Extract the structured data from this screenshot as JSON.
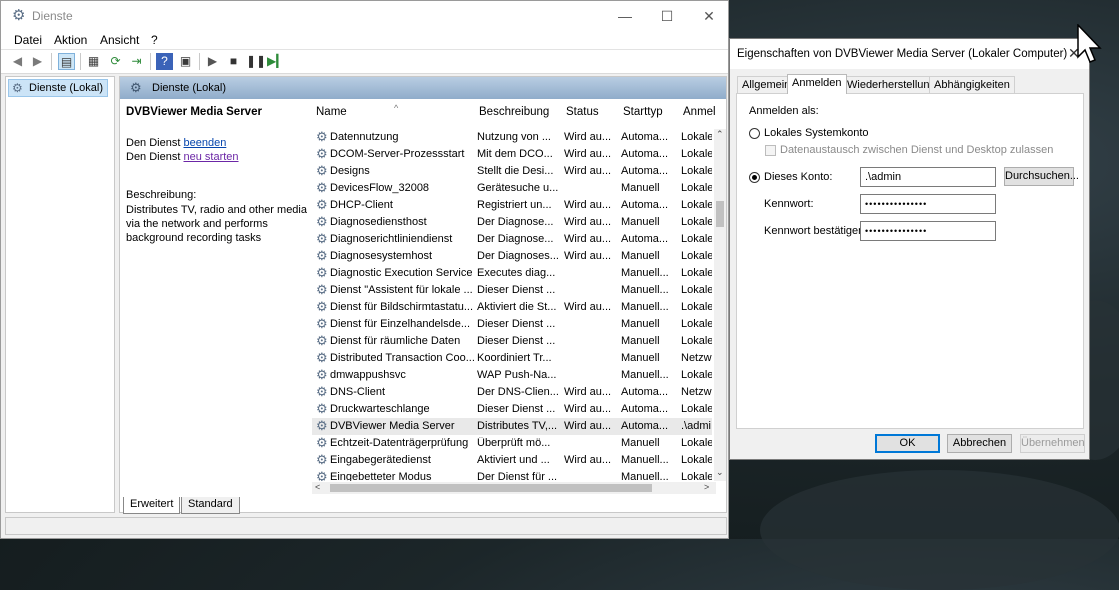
{
  "window": {
    "title": "Dienste",
    "menu": [
      "Datei",
      "Aktion",
      "Ansicht",
      "?"
    ]
  },
  "tree": {
    "item": "Dienste (Lokal)"
  },
  "content": {
    "header": "Dienste (Lokal)",
    "selected_service": "DVBViewer Media Server",
    "action1_prefix": "Den Dienst ",
    "action1_link": "beenden",
    "action2_prefix": "Den Dienst ",
    "action2_link": "neu starten",
    "desc_label": "Beschreibung:",
    "desc_text": "Distributes TV, radio and other media via the network and performs background recording tasks"
  },
  "table": {
    "columns": [
      "Name",
      "Beschreibung",
      "Status",
      "Starttyp",
      "Anmel"
    ],
    "rows": [
      [
        "Datennutzung",
        "Nutzung von ...",
        "Wird au...",
        "Automa...",
        "Lokale"
      ],
      [
        "DCOM-Server-Prozessstart",
        "Mit dem DCO...",
        "Wird au...",
        "Automa...",
        "Lokale"
      ],
      [
        "Designs",
        "Stellt die Desi...",
        "Wird au...",
        "Automa...",
        "Lokale"
      ],
      [
        "DevicesFlow_32008",
        "Gerätesuche u...",
        "",
        "Manuell",
        "Lokale"
      ],
      [
        "DHCP-Client",
        "Registriert un...",
        "Wird au...",
        "Automa...",
        "Lokale"
      ],
      [
        "Diagnosediensthost",
        "Der Diagnose...",
        "Wird au...",
        "Manuell",
        "Lokale"
      ],
      [
        "Diagnoserichtliniendienst",
        "Der Diagnose...",
        "Wird au...",
        "Automa...",
        "Lokale"
      ],
      [
        "Diagnosesystemhost",
        "Der Diagnoses...",
        "Wird au...",
        "Manuell",
        "Lokale"
      ],
      [
        "Diagnostic Execution Service",
        "Executes diag...",
        "",
        "Manuell...",
        "Lokale"
      ],
      [
        "Dienst \"Assistent für lokale ...",
        "Dieser Dienst ...",
        "",
        "Manuell...",
        "Lokale"
      ],
      [
        "Dienst für Bildschirmtastatu...",
        "Aktiviert die St...",
        "Wird au...",
        "Manuell...",
        "Lokale"
      ],
      [
        "Dienst für Einzelhandelsde...",
        "Dieser Dienst ...",
        "",
        "Manuell",
        "Lokale"
      ],
      [
        "Dienst für räumliche Daten",
        "Dieser Dienst ...",
        "",
        "Manuell",
        "Lokale"
      ],
      [
        "Distributed Transaction Coo...",
        "Koordiniert Tr...",
        "",
        "Manuell",
        "Netzw"
      ],
      [
        "dmwappushsvc",
        "WAP Push-Na...",
        "",
        "Manuell...",
        "Lokale"
      ],
      [
        "DNS-Client",
        "Der DNS-Clien...",
        "Wird au...",
        "Automa...",
        "Netzw"
      ],
      [
        "Druckwarteschlange",
        "Dieser Dienst ...",
        "Wird au...",
        "Automa...",
        "Lokale"
      ],
      [
        "DVBViewer Media Server",
        "Distributes TV,...",
        "Wird au...",
        "Automa...",
        ".\\admi"
      ],
      [
        "Echtzeit-Datenträgerprüfung",
        "Überprüft mö...",
        "",
        "Manuell",
        "Lokale"
      ],
      [
        "Eingabegerätedienst",
        "Aktiviert und ...",
        "Wird au...",
        "Manuell...",
        "Lokale"
      ],
      [
        "Eingebetteter Modus",
        "Der Dienst für ...",
        "",
        "Manuell...",
        "Lokale"
      ]
    ],
    "selected_index": 17
  },
  "view_tabs": [
    "Erweitert",
    "Standard"
  ],
  "dialog": {
    "title": "Eigenschaften von DVBViewer Media Server (Lokaler Computer)",
    "tabs": [
      "Allgemein",
      "Anmelden",
      "Wiederherstellung",
      "Abhängigkeiten"
    ],
    "active_tab": "Anmelden",
    "logon_as": "Anmelden als:",
    "local_system": "Lokales Systemkonto",
    "desktop_interact": "Datenaustausch zwischen Dienst und Desktop zulassen",
    "this_account": "Dieses Konto:",
    "account_value": ".\\admin",
    "browse": "Durchsuchen...",
    "password_label": "Kennwort:",
    "password_value": "•••••••••••••••",
    "confirm_label": "Kennwort bestätigen:",
    "confirm_value": "•••••••••••••••",
    "ok": "OK",
    "cancel": "Abbrechen",
    "apply": "Übernehmen"
  }
}
